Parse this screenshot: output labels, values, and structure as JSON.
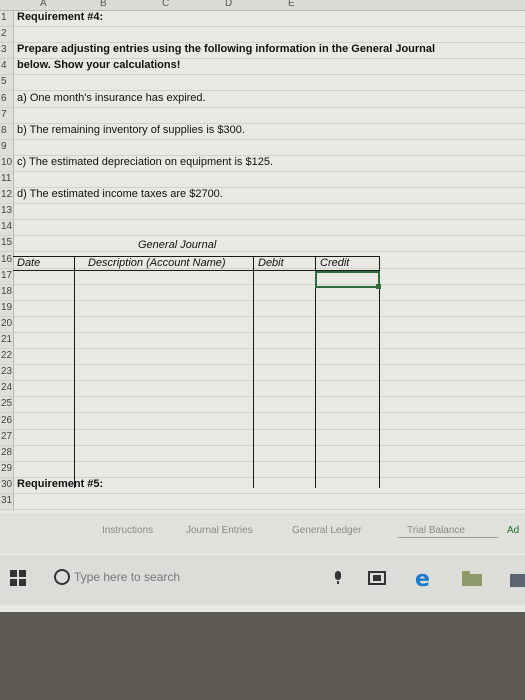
{
  "columns": [
    "A",
    "B",
    "C",
    "D",
    "E"
  ],
  "rows": [
    {
      "num": "1",
      "text": "Requirement #4:",
      "bold": true
    },
    {
      "num": "2",
      "text": ""
    },
    {
      "num": "3",
      "text": "Prepare adjusting entries using the following information in the General Journal",
      "bold": true
    },
    {
      "num": "4",
      "text": "below. Show your calculations!",
      "bold": true
    },
    {
      "num": "5",
      "text": ""
    },
    {
      "num": "6",
      "text": "a) One month's insurance has expired."
    },
    {
      "num": "7",
      "text": ""
    },
    {
      "num": "8",
      "text": "b) The remaining inventory of supplies is $300."
    },
    {
      "num": "9",
      "text": ""
    },
    {
      "num": "10",
      "text": "c) The estimated depreciation on equipment is $125."
    },
    {
      "num": "11",
      "text": ""
    },
    {
      "num": "12",
      "text": "d) The estimated income taxes are $2700."
    },
    {
      "num": "13",
      "text": ""
    },
    {
      "num": "14",
      "text": ""
    },
    {
      "num": "15",
      "text": ""
    },
    {
      "num": "16",
      "text": ""
    },
    {
      "num": "17",
      "text": ""
    },
    {
      "num": "18",
      "text": ""
    },
    {
      "num": "19",
      "text": ""
    },
    {
      "num": "20",
      "text": ""
    },
    {
      "num": "21",
      "text": ""
    },
    {
      "num": "22",
      "text": ""
    },
    {
      "num": "23",
      "text": ""
    },
    {
      "num": "24",
      "text": ""
    },
    {
      "num": "25",
      "text": ""
    },
    {
      "num": "26",
      "text": ""
    },
    {
      "num": "27",
      "text": ""
    },
    {
      "num": "28",
      "text": ""
    },
    {
      "num": "29",
      "text": ""
    },
    {
      "num": "30",
      "text": "Requirement #5:",
      "bold": true
    },
    {
      "num": "31",
      "text": ""
    }
  ],
  "journal": {
    "title": "General Journal",
    "date": "Date",
    "description": "Description (Account Name)",
    "debit": "Debit",
    "credit": "Credit"
  },
  "sheet_tabs": [
    {
      "label": "Instructions"
    },
    {
      "label": "Journal Entries"
    },
    {
      "label": "General Ledger"
    },
    {
      "label": "Trial Balance",
      "active": true
    },
    {
      "label": "Ad"
    }
  ],
  "taskbar": {
    "search_placeholder": "Type here to search"
  }
}
